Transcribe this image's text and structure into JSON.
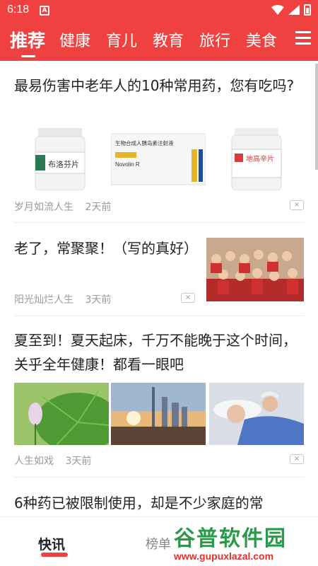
{
  "status": {
    "time": "6:18",
    "notification_glyph": "A"
  },
  "tabs": [
    {
      "label": "推荐",
      "active": true
    },
    {
      "label": "健康"
    },
    {
      "label": "育儿"
    },
    {
      "label": "教育"
    },
    {
      "label": "旅行"
    },
    {
      "label": "美食"
    }
  ],
  "articles": [
    {
      "title": "最易伤害中老年人的10种常用药，您有吃吗?",
      "source": "岁月如流人生",
      "time": "2天前",
      "images": [
        "medicine-bottle-buluofen",
        "insulin-box-novolin",
        "medicine-bottle-digaoxin"
      ],
      "image_text": [
        "布洛芬片",
        "生物合成人胰岛素注射液",
        "Novolin R",
        "地高辛片"
      ]
    },
    {
      "title": "老了，常聚聚！（写的真好）",
      "source": "阳光灿烂人生",
      "time": "3天前",
      "images": [
        "elderly-group-photo"
      ]
    },
    {
      "title": "夏至到！夏天起床，千万不能晚于这个时间，关乎全年健康！都看一眼吧",
      "source": "人生如戏",
      "time": "3天前",
      "images": [
        "lotus-leaf",
        "city-sunset",
        "sleeping-elderly-couple"
      ]
    },
    {
      "title": "6种药已被限制使用，却是不少家庭的常"
    }
  ],
  "close_glyph": "×",
  "bottom_nav": [
    {
      "label": "快讯",
      "active": true
    },
    {
      "label": "榜单"
    }
  ],
  "watermark": {
    "main": "谷普软件园",
    "sub": "www.gupuxlazal.com"
  },
  "colors": {
    "brand_red": "#f04141",
    "meta_gray": "#9a9a9a",
    "watermark_green": "#2a9a4a"
  }
}
